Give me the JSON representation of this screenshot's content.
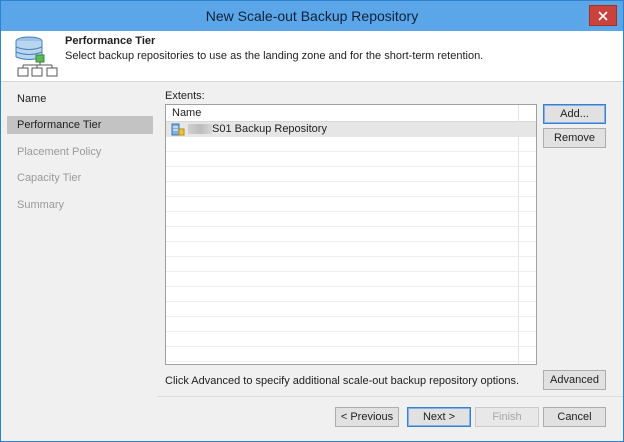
{
  "window": {
    "title": "New Scale-out Backup Repository"
  },
  "header": {
    "title": "Performance Tier",
    "description": "Select backup repositories to use as the landing zone and for the short-term retention."
  },
  "sidebar": {
    "items": [
      {
        "label": "Name",
        "state": "done"
      },
      {
        "label": "Performance Tier",
        "state": "active"
      },
      {
        "label": "Placement Policy",
        "state": "pending"
      },
      {
        "label": "Capacity Tier",
        "state": "pending"
      },
      {
        "label": "Summary",
        "state": "pending"
      }
    ]
  },
  "extents": {
    "label": "Extents:",
    "column_name": "Name",
    "rows": [
      {
        "name": "S01 Backup Repository"
      }
    ]
  },
  "buttons": {
    "add": "Add...",
    "remove": "Remove",
    "advanced": "Advanced",
    "previous": "< Previous",
    "next": "Next >",
    "finish": "Finish",
    "cancel": "Cancel"
  },
  "hint": "Click Advanced to specify additional scale-out backup repository options.",
  "colors": {
    "titlebar": "#5aa6e8",
    "close": "#c8433c",
    "sidebar_active": "#c3c3c3"
  }
}
